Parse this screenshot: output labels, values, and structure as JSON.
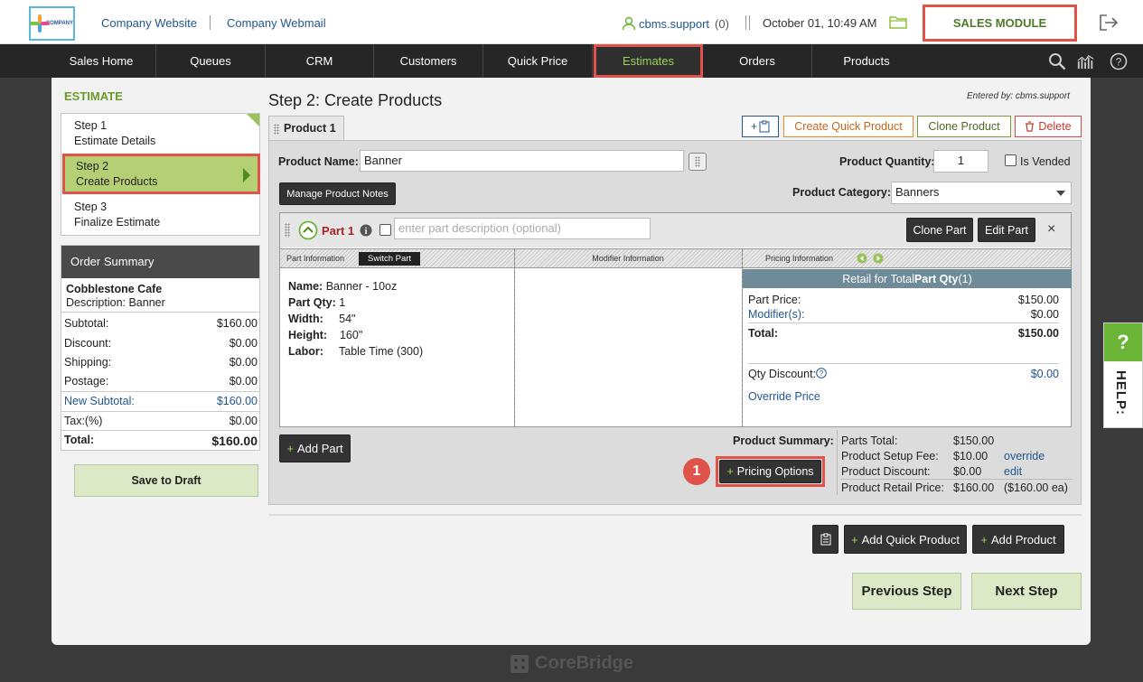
{
  "top": {
    "logo_text": "COMPANY",
    "links": [
      "Company Website",
      "Company Webmail"
    ],
    "user": "cbms.support",
    "user_count": "(0)",
    "datetime": "October 01, 10:49 AM",
    "module": "SALES MODULE"
  },
  "nav": {
    "items": [
      "Sales Home",
      "Queues",
      "CRM",
      "Customers",
      "Quick Price",
      "Estimates",
      "Orders",
      "Products"
    ]
  },
  "sidebar": {
    "heading": "ESTIMATE",
    "steps": [
      {
        "title": "Step 1",
        "subtitle": "Estimate Details"
      },
      {
        "title": "Step 2",
        "subtitle": "Create Products"
      },
      {
        "title": "Step 3",
        "subtitle": "Finalize Estimate"
      }
    ],
    "summary": {
      "heading": "Order Summary",
      "customer": "Cobblestone Cafe",
      "description": "Description:  Banner",
      "rows": [
        {
          "label": "Subtotal:",
          "value": "$160.00"
        },
        {
          "label": "Discount:",
          "value": "$0.00"
        },
        {
          "label": "Shipping:",
          "value": "$0.00"
        },
        {
          "label": "Postage:",
          "value": "$0.00"
        },
        {
          "label": "New Subtotal:",
          "value": "$160.00"
        },
        {
          "label": "Tax:(%)",
          "value": "$0.00"
        },
        {
          "label": "Total:",
          "value": "$160.00"
        }
      ]
    },
    "save_draft": "Save to Draft"
  },
  "main": {
    "title": "Step 2: Create Products",
    "entered_by": "Entered by: cbms.support",
    "tab": "Product 1",
    "buttons": {
      "add_note": "+",
      "create_quick": "Create Quick Product",
      "clone_product": "Clone Product",
      "delete": "Delete"
    },
    "product_name_label": "Product Name:",
    "product_name": "Banner",
    "quantity_label": "Product Quantity:",
    "quantity": "1",
    "vended_label": "Is Vended",
    "manage_notes": "Manage Product Notes",
    "category_label": "Product Category:",
    "category": "Banners",
    "part": {
      "name": "Part 1",
      "desc_placeholder": "enter part description (optional)",
      "clone": "Clone Part",
      "edit": "Edit Part",
      "close": "×",
      "col_part_info": "Part Information",
      "switch_part": "Switch Part",
      "col_modifier": "Modifier Information",
      "col_pricing": "Pricing Information",
      "info": [
        {
          "label": "Name:",
          "value": "Banner - 10oz"
        },
        {
          "label": "Part Qty:",
          "value": "1"
        },
        {
          "label": "Width:",
          "value": "54\""
        },
        {
          "label": "Height:",
          "value": "160\""
        },
        {
          "label": "Labor:",
          "value": "Table Time (300)"
        }
      ],
      "retail_head_pre": "Retail for Total ",
      "retail_head_bold": "Part Qty",
      "retail_head_post": " (1)",
      "part_price_label": "Part Price:",
      "part_price": "$150.00",
      "modifiers_label": "Modifier(s):",
      "modifiers": "$0.00",
      "total_label": "Total:",
      "total": "$150.00",
      "qty_discount_label": "Qty Discount:",
      "qty_discount": "$0.00",
      "override_price": "Override Price"
    },
    "add_part": "Add Part",
    "pricing_options": "Pricing Options",
    "step_badge": "1",
    "product_summary": {
      "label": "Product Summary:",
      "rows": [
        {
          "label": "Parts Total:",
          "value": "$150.00",
          "extra": ""
        },
        {
          "label": "Product Setup Fee:",
          "value": "$10.00",
          "extra": "override"
        },
        {
          "label": "Product Discount:",
          "value": "$0.00",
          "extra": "edit"
        },
        {
          "label": "Product Retail Price:",
          "value": "$160.00",
          "extra": "($160.00 ea)"
        }
      ]
    },
    "add_quick_product": "Add Quick Product",
    "add_product": "Add Product",
    "previous_step": "Previous Step",
    "next_step": "Next Step"
  },
  "help": {
    "q": "?",
    "label": "HELP:"
  },
  "footer": {
    "brand": "CoreBridge"
  },
  "colors": {
    "accent_green": "#9ad25a",
    "highlight_red": "#e0534a",
    "nav_bg": "#262626",
    "link_blue": "#22568f"
  }
}
